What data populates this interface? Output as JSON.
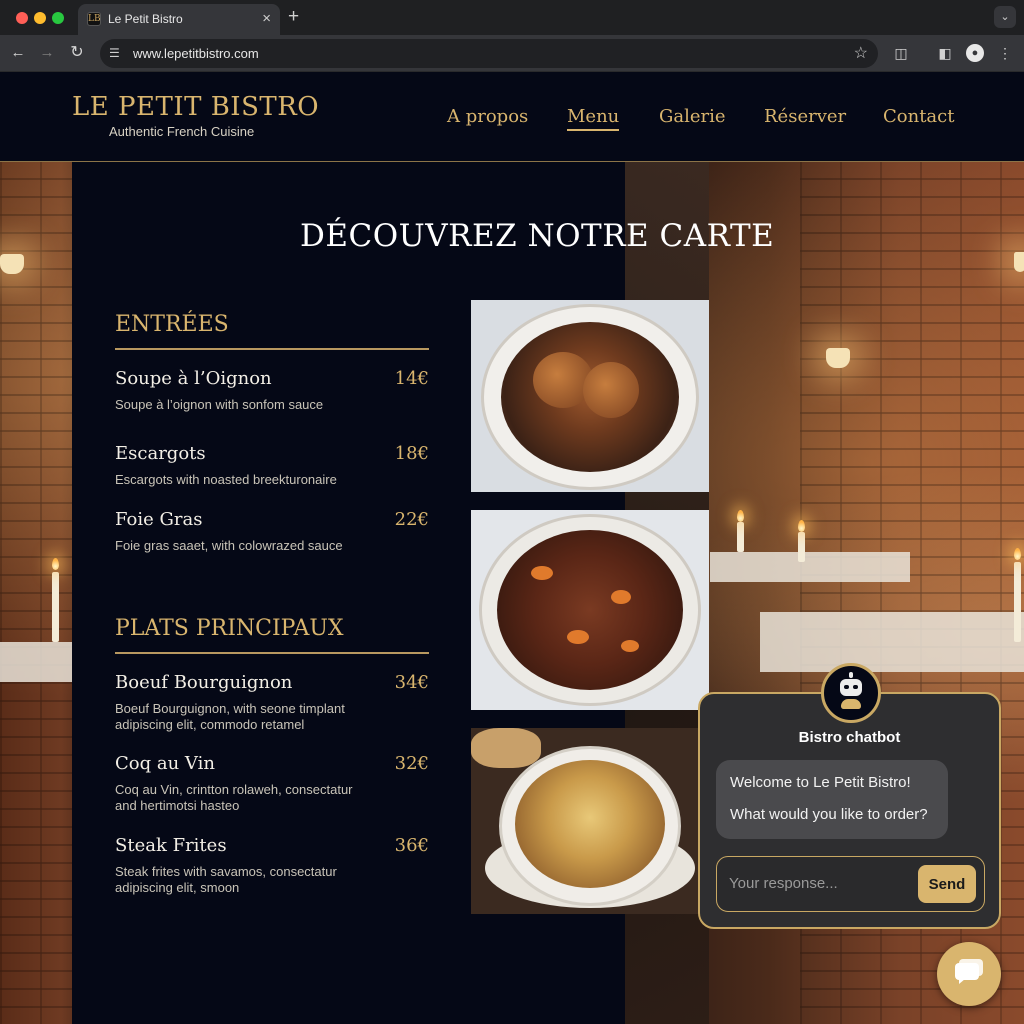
{
  "browser": {
    "tab_title": "Le Petit Bistro",
    "tab_favicon_text": "LB",
    "tab_close_glyph": "×",
    "new_tab_glyph": "+",
    "url": "www.lepetitbistro.com",
    "icons": [
      "back-arrow-icon",
      "forward-arrow-icon",
      "reload-icon",
      "site-info-icon",
      "star-icon",
      "extensions-icon",
      "side-panel-icon",
      "profile-icon",
      "kebab-menu-icon",
      "tab-search-icon"
    ]
  },
  "site": {
    "name": "LE PETIT BISTRO",
    "tagline": "Authentic French Cuisine",
    "nav": [
      {
        "label": "A propos",
        "active": false
      },
      {
        "label": "Menu",
        "active": true
      },
      {
        "label": "Galerie",
        "active": false
      },
      {
        "label": "Réserver",
        "active": false
      },
      {
        "label": "Contact",
        "active": false
      }
    ],
    "accent_color": "#d9b56e",
    "background_color": "#050816"
  },
  "menu": {
    "heading": "DÉCOUVREZ NOTRE CARTE",
    "sections": [
      {
        "title": "ENTRÉES",
        "items": [
          {
            "name": "Soupe à l’Oignon",
            "price": "14€",
            "desc_lines": [
              "Soupe à l’oignon with sonfom sauce"
            ]
          },
          {
            "name": "Escargots",
            "price": "18€",
            "desc_lines": [
              "Escargots with noasted breekturonaire"
            ]
          },
          {
            "name": "Foie Gras",
            "price": "22€",
            "desc_lines": [
              "Foie gras saaet, with colowrazed sauce"
            ]
          }
        ]
      },
      {
        "title": "PLATS PRINCIPAUX",
        "items": [
          {
            "name": "Boeuf Bourguignon",
            "price": "34€",
            "desc_lines": [
              "Boeuf Bourguignon, with seone timplant",
              "adipiscing elit, commodo retamel"
            ]
          },
          {
            "name": "Coq au Vin",
            "price": "32€",
            "desc_lines": [
              "Coq au Vin, crintton rolaweh, consectatur",
              "and hertimotsi hasteo"
            ]
          },
          {
            "name": "Steak Frites",
            "price": "36€",
            "desc_lines": [
              "Steak frites with savamos, consectatur",
              "adipiscing elit, smoon"
            ]
          }
        ]
      }
    ],
    "photos": [
      "coq-au-vin-photo",
      "boeuf-bourguignon-photo",
      "onion-soup-photo"
    ]
  },
  "chatbot": {
    "title": "Bistro chatbot",
    "messages": [
      {
        "from": "bot",
        "lines": [
          "Welcome to Le Petit Bistro!",
          "What would you like to order?"
        ]
      }
    ],
    "input_placeholder": "Your response...",
    "input_value": "",
    "send_label": "Send",
    "avatar_icon": "robot-icon",
    "launcher_icon": "chat-bubble-icon"
  }
}
